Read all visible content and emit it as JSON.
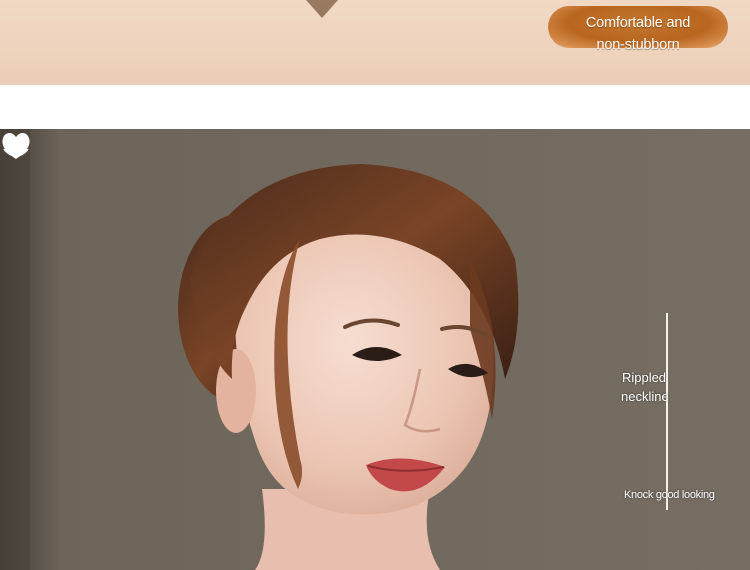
{
  "banner": {
    "pill_line1": "Comfortable and",
    "pill_line2": "non-stubborn",
    "background_color": "#efd6c1",
    "pill_color": "#b8661f"
  },
  "side_panel": {
    "heart_icon": "heart-icon",
    "feature_line1": "Rippled",
    "feature_line2": "neckline",
    "caption": "Knock good looking"
  }
}
